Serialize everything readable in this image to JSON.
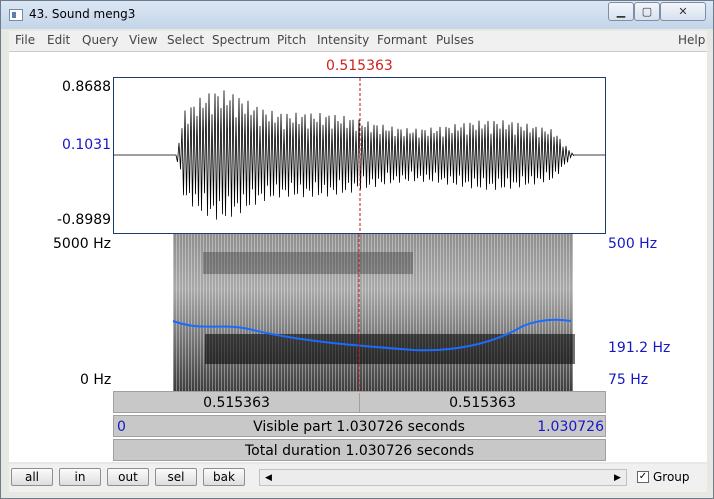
{
  "window": {
    "title": "43. Sound meng3"
  },
  "menu": {
    "items": [
      "File",
      "Edit",
      "Query",
      "View",
      "Select",
      "Spectrum",
      "Pitch",
      "Intensity",
      "Formant",
      "Pulses"
    ],
    "help": "Help"
  },
  "cursor": {
    "time": "0.515363",
    "fraction": 0.5
  },
  "waveform": {
    "max": "0.8688",
    "cursor_value": "0.1031",
    "min": "-0.8989"
  },
  "spectrogram": {
    "freq_top": "5000 Hz",
    "freq_bottom": "0 Hz",
    "pitch_top": "500 Hz",
    "pitch_mid": "191.2 Hz",
    "pitch_bottom": "75 Hz"
  },
  "time_bar": {
    "left": "0.515363",
    "right": "0.515363"
  },
  "visible_bar": {
    "start": "0",
    "text": "Visible part 1.030726 seconds",
    "end": "1.030726"
  },
  "total_bar": {
    "text": "Total duration 1.030726 seconds"
  },
  "buttons": {
    "all": "all",
    "in": "in",
    "out": "out",
    "sel": "sel",
    "bak": "bak"
  },
  "group": {
    "label": "Group",
    "checked": true
  }
}
